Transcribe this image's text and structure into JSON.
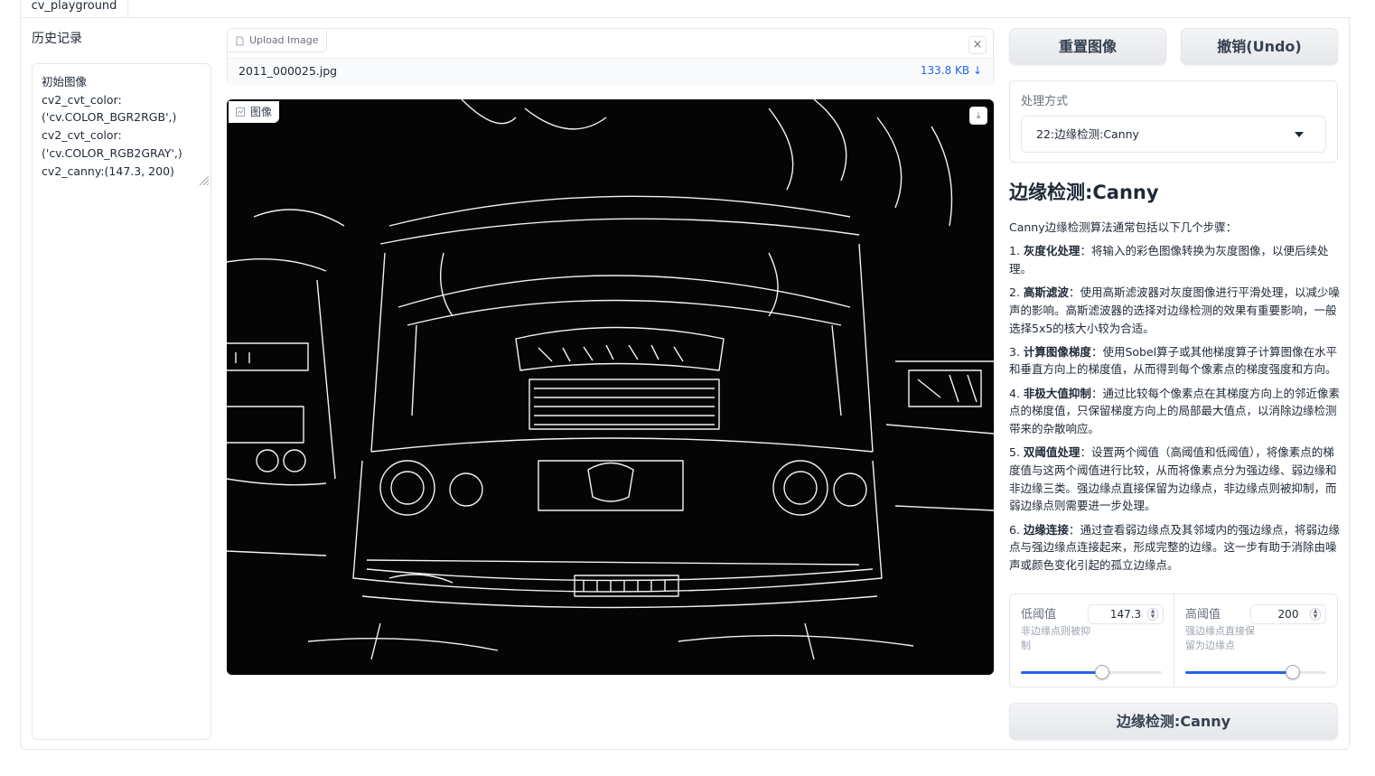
{
  "tabs": [
    {
      "label": "cv_playground"
    }
  ],
  "history": {
    "label": "历史记录",
    "content": "初始图像\ncv2_cvt_color:\n('cv.COLOR_BGR2RGB',)\ncv2_cvt_color:\n('cv.COLOR_RGB2GRAY',)\ncv2_canny:(147.3, 200)"
  },
  "upload": {
    "label": "Upload Image",
    "file_name": "2011_000025.jpg",
    "file_size": "133.8 KB ↓",
    "close_glyph": "×"
  },
  "image": {
    "label": "图像",
    "download_glyph": "⤓"
  },
  "buttons": {
    "reset": "重置图像",
    "undo": "撤销(Undo)",
    "apply": "边缘检测:Canny"
  },
  "method": {
    "label": "处理方式",
    "selected": "22:边缘检测:Canny"
  },
  "description": {
    "title": "边缘检测:Canny",
    "intro": "Canny边缘检测算法通常包括以下几个步骤：",
    "steps": [
      {
        "num": "1.",
        "title": "灰度化处理",
        "text": "：将输入的彩色图像转换为灰度图像，以便后续处理。"
      },
      {
        "num": "2.",
        "title": "高斯滤波",
        "text": "：使用高斯滤波器对灰度图像进行平滑处理，以减少噪声的影响。高斯滤波器的选择对边缘检测的效果有重要影响，一般选择5x5的核大小较为合适。"
      },
      {
        "num": "3.",
        "title": "计算图像梯度",
        "text": "：使用Sobel算子或其他梯度算子计算图像在水平和垂直方向上的梯度值，从而得到每个像素点的梯度强度和方向。"
      },
      {
        "num": "4.",
        "title": "非极大值抑制",
        "text": "：通过比较每个像素点在其梯度方向上的邻近像素点的梯度值，只保留梯度方向上的局部最大值点，以消除边缘检测带来的杂散响应。"
      },
      {
        "num": "5.",
        "title": "双阈值处理",
        "text": "：设置两个阈值（高阈值和低阈值），将像素点的梯度值与这两个阈值进行比较，从而将像素点分为强边缘、弱边缘和非边缘三类。强边缘点直接保留为边缘点，非边缘点则被抑制，而弱边缘点则需要进一步处理。"
      },
      {
        "num": "6.",
        "title": "边缘连接",
        "text": "：通过查看弱边缘点及其邻域内的强边缘点，将弱边缘点与强边缘点连接起来，形成完整的边缘。这一步有助于消除由噪声或颜色变化引起的孤立边缘点。"
      }
    ]
  },
  "sliders": {
    "low": {
      "label": "低阈值",
      "info": "非边缘点则被抑制",
      "value": "147.3",
      "fraction": 0.574
    },
    "high": {
      "label": "高阈值",
      "info": "强边缘点直接保留为边缘点",
      "value": "200",
      "fraction": 0.762
    }
  },
  "colors": {
    "accent": "#2563eb",
    "edge": "#f2f2f2",
    "bg": "#050505"
  }
}
